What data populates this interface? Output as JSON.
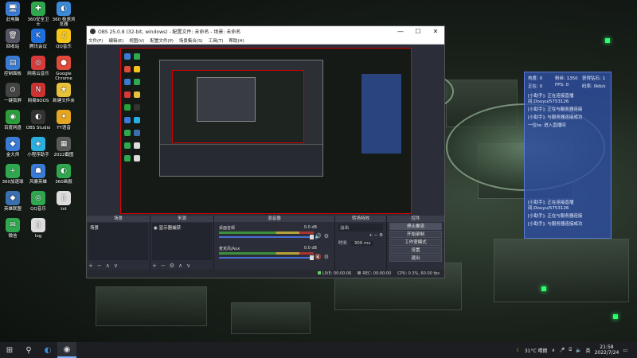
{
  "desktop": {
    "icons": [
      {
        "label": "此电脑",
        "glyph": "🖥",
        "color": "#3a7bd5"
      },
      {
        "label": "360安全卫士",
        "glyph": "✚",
        "color": "#2fa84f"
      },
      {
        "label": "360 极速浏览器",
        "glyph": "◐",
        "color": "#3c8bd9"
      },
      {
        "label": "回收站",
        "glyph": "🗑",
        "color": "#556"
      },
      {
        "label": "腾讯会议",
        "glyph": "K",
        "color": "#1f6fe0"
      },
      {
        "label": "QQ音乐",
        "glyph": "♫",
        "color": "#f5c518"
      },
      {
        "label": "控制面板",
        "glyph": "▤",
        "color": "#3a7bd5"
      },
      {
        "label": "网易云音乐",
        "glyph": "◎",
        "color": "#d83a3a"
      },
      {
        "label": "Google Chrome",
        "glyph": "●",
        "color": "#e04a3a"
      },
      {
        "label": "一键锁屏",
        "glyph": "⊙",
        "color": "#444"
      },
      {
        "label": "网易BOOS",
        "glyph": "N",
        "color": "#c33"
      },
      {
        "label": "新建文件夹",
        "glyph": "★",
        "color": "#e8c13a"
      },
      {
        "label": "百度网盘",
        "glyph": "◉",
        "color": "#2a9f3a"
      },
      {
        "label": "OBS Studio",
        "glyph": "◐",
        "color": "#333"
      },
      {
        "label": "YY语音",
        "glyph": "✦",
        "color": "#e5a623"
      },
      {
        "label": "金大师",
        "glyph": "◆",
        "color": "#3a7bd5"
      },
      {
        "label": "小程序助手",
        "glyph": "◈",
        "color": "#2ab0e0"
      },
      {
        "label": "2022截图",
        "glyph": "▦",
        "color": "#5a5a5a"
      },
      {
        "label": "360加速球",
        "glyph": "+",
        "color": "#2fa84f"
      },
      {
        "label": "风暴英雄",
        "glyph": "☗",
        "color": "#3a7bd5"
      },
      {
        "label": "360画报",
        "glyph": "◐",
        "color": "#2fa84f"
      },
      {
        "label": "英雄联盟",
        "glyph": "◆",
        "color": "#3a6fb0"
      },
      {
        "label": "QQ音乐",
        "glyph": "◎",
        "color": "#2fa84f"
      },
      {
        "label": "txt",
        "glyph": "▯",
        "color": "#ddd"
      },
      {
        "label": "微信",
        "glyph": "✉",
        "color": "#2fa84f"
      },
      {
        "label": "log",
        "glyph": "▯",
        "color": "#ddd"
      }
    ]
  },
  "obs": {
    "title": "OBS 25.0.8 (32-bit, windows) - 配置文件: 未命名 - 场景: 未命名",
    "controls": [
      "—",
      "☐",
      "✕"
    ],
    "menu": [
      "文件(F)",
      "编辑(E)",
      "视图(V)",
      "配置文件(P)",
      "场景集合(S)",
      "工具(T)",
      "帮助(H)"
    ],
    "docks": {
      "scenes": {
        "title": "场景",
        "item": "场景"
      },
      "sources": {
        "title": "来源",
        "item": "显示器捕获"
      },
      "mixer": {
        "title": "混音器",
        "rows": [
          {
            "name": "桌面音频",
            "db": "0.0 dB"
          },
          {
            "name": "麦克风/Aux",
            "db": "0.0 dB"
          }
        ]
      },
      "transitions": {
        "title": "转场特效",
        "type": "淡出",
        "duration_label": "时长",
        "duration": "300 ms"
      },
      "controls": {
        "title": "控件",
        "buttons": [
          "停止推流",
          "开始录制",
          "工作室模式",
          "设置",
          "退出"
        ]
      }
    },
    "status": {
      "live": "LIVE: 00:00:06",
      "rec": "REC: 00:00:00",
      "cpu": "CPU: 0.3%, 60.00 fps"
    }
  },
  "live_panel": {
    "stats": [
      "热度: 0",
      "粉丝: 1350",
      "获得钻石: 1",
      "正在: 0",
      "FPS: 0",
      "码率: 0kb/s"
    ],
    "messages_top": [
      "[小助手]: 正在连接直播间,Douyu/5753126",
      "[小助手]: 正在与服务器连接",
      "[小助手]: 与服务器连接成功",
      "一位ta: 进入直播间"
    ],
    "messages_bottom": [
      "[小助手]: 正在连接直播间,Douyu/5753126",
      "[小助手]: 正在与服务器连接",
      "[小助手]: 与服务器连接成功"
    ]
  },
  "taskbar": {
    "weather": "31°C  晴朗",
    "lang": "英",
    "time": "21:58",
    "date": "2022/7/24"
  }
}
